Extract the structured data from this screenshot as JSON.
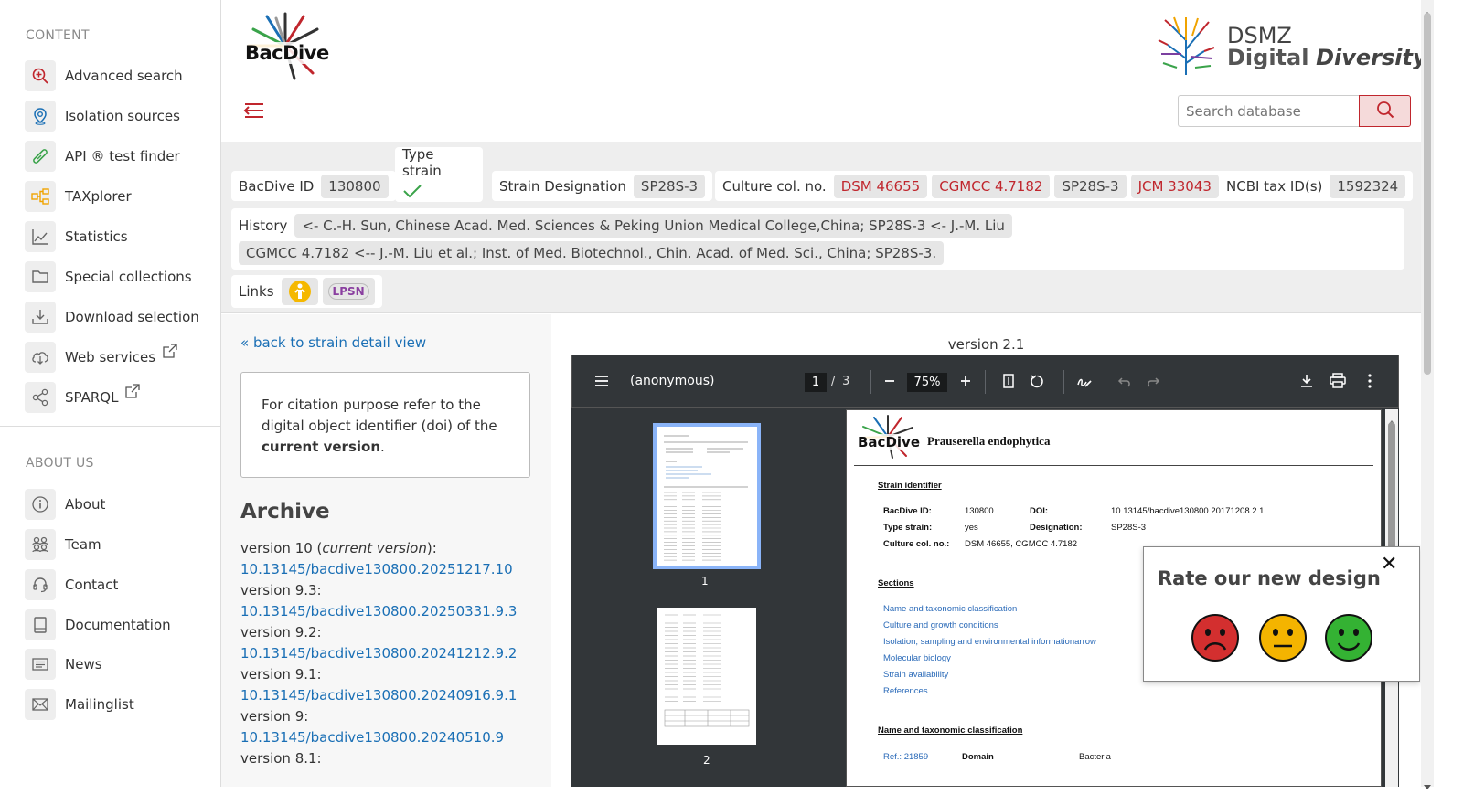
{
  "sidebar": {
    "content_heading": "CONTENT",
    "about_heading": "ABOUT US",
    "items": [
      {
        "label": "Advanced search",
        "icon": "search-plus-icon"
      },
      {
        "label": "Isolation sources",
        "icon": "map-pin-icon"
      },
      {
        "label": "API ® test finder",
        "icon": "test-tube-icon"
      },
      {
        "label": "TAXplorer",
        "icon": "hierarchy-icon"
      },
      {
        "label": "Statistics",
        "icon": "line-chart-icon"
      },
      {
        "label": "Special collections",
        "icon": "folder-icon"
      },
      {
        "label": "Download selection",
        "icon": "download-icon"
      },
      {
        "label": "Web services",
        "icon": "cloud-download-icon"
      },
      {
        "label": "SPARQL",
        "icon": "share-nodes-icon"
      }
    ],
    "about_items": [
      {
        "label": "About",
        "icon": "info-circle-icon"
      },
      {
        "label": "Team",
        "icon": "people-icon"
      },
      {
        "label": "Contact",
        "icon": "headset-icon"
      },
      {
        "label": "Documentation",
        "icon": "book-icon"
      },
      {
        "label": "News",
        "icon": "newspaper-icon"
      },
      {
        "label": "Mailinglist",
        "icon": "envelope-icon"
      }
    ]
  },
  "header": {
    "logo_text": "BacDive",
    "dsmz_line1": "DSMZ",
    "dsmz_line2a": "Digital",
    "dsmz_line2b": "Diversity",
    "search_placeholder": "Search database"
  },
  "strain": {
    "bacdive_id_label": "BacDive ID",
    "bacdive_id": "130800",
    "type_strain_label": "Type strain",
    "designation_label": "Strain Designation",
    "designation": "SP28S-3",
    "culture_label": "Culture col. no.",
    "culture_nos": [
      "DSM 46655",
      "CGMCC 4.7182",
      "SP28S-3",
      "JCM 33043"
    ],
    "ncbi_label": "NCBI tax ID(s)",
    "ncbi_id": "1592324",
    "history_label": "History",
    "history_1": "<- C.-H. Sun, Chinese Acad. Med. Sciences & Peking Union Medical College,China; SP28S-3 <- J.-M. Liu",
    "history_2": "CGMCC 4.7182 <-- J.-M. Liu et al.; Inst. of Med. Biotechnol., Chin. Acad. of Med. Sci., China; SP28S-3.",
    "links_label": "Links",
    "lpsn_label": "LPSN"
  },
  "left": {
    "back_link": "« back to strain detail view",
    "citation_1": "For citation purpose refer to the digital object identifier (doi) of the",
    "citation_bold": "current version",
    "citation_end": ".",
    "archive_title": "Archive",
    "versions": [
      {
        "label": "version 10 (",
        "italic": "current version",
        "after": "):",
        "doi": "10.13145/bacdive130800.20251217.10"
      },
      {
        "label": "version 9.3:",
        "doi": "10.13145/bacdive130800.20250331.9.3"
      },
      {
        "label": "version 9.2:",
        "doi": "10.13145/bacdive130800.20241212.9.2"
      },
      {
        "label": "version 9.1:",
        "doi": "10.13145/bacdive130800.20240916.9.1"
      },
      {
        "label": "version 9:",
        "doi": "10.13145/bacdive130800.20240510.9"
      },
      {
        "label": "version 8.1:",
        "doi": ""
      }
    ]
  },
  "pdf": {
    "version_title": "version 2.1",
    "doc_title": "(anonymous)",
    "page_current": "1",
    "page_total": "3",
    "zoom": "75%",
    "thumb_labels": [
      "1",
      "2"
    ],
    "page": {
      "species": "Prauserella endophytica",
      "strain_identifier": "Strain identifier",
      "bacdive_id_k": "BacDive ID:",
      "bacdive_id_v": "130800",
      "doi_k": "DOI:",
      "doi_v": "10.13145/bacdive130800.20171208.2.1",
      "type_strain_k": "Type strain:",
      "type_strain_v": "yes",
      "designation_k": "Designation:",
      "designation_v": "SP28S-3",
      "culture_k": "Culture col. no.:",
      "culture_v": "DSM 46655, CGMCC 4.7182",
      "sections_title": "Sections",
      "sections": [
        "Name and taxonomic classification",
        "Culture and growth conditions",
        "Isolation, sampling and environmental informationarrow",
        "Molecular biology",
        "Strain availability",
        "References"
      ],
      "ntc_title": "Name and taxonomic classification",
      "ref_1": "Ref.: 21859",
      "domain_k": "Domain",
      "domain_v": "Bacteria"
    }
  },
  "rating": {
    "title": "Rate our new design",
    "close": "✕",
    "faces": [
      "sad-face-icon",
      "neutral-face-icon",
      "happy-face-icon"
    ],
    "colors": {
      "sad": "#d32f2f",
      "neutral": "#f4b400",
      "happy": "#34b233"
    }
  },
  "colors": {
    "accent": "#c0262d",
    "link": "#1a6fb5"
  }
}
